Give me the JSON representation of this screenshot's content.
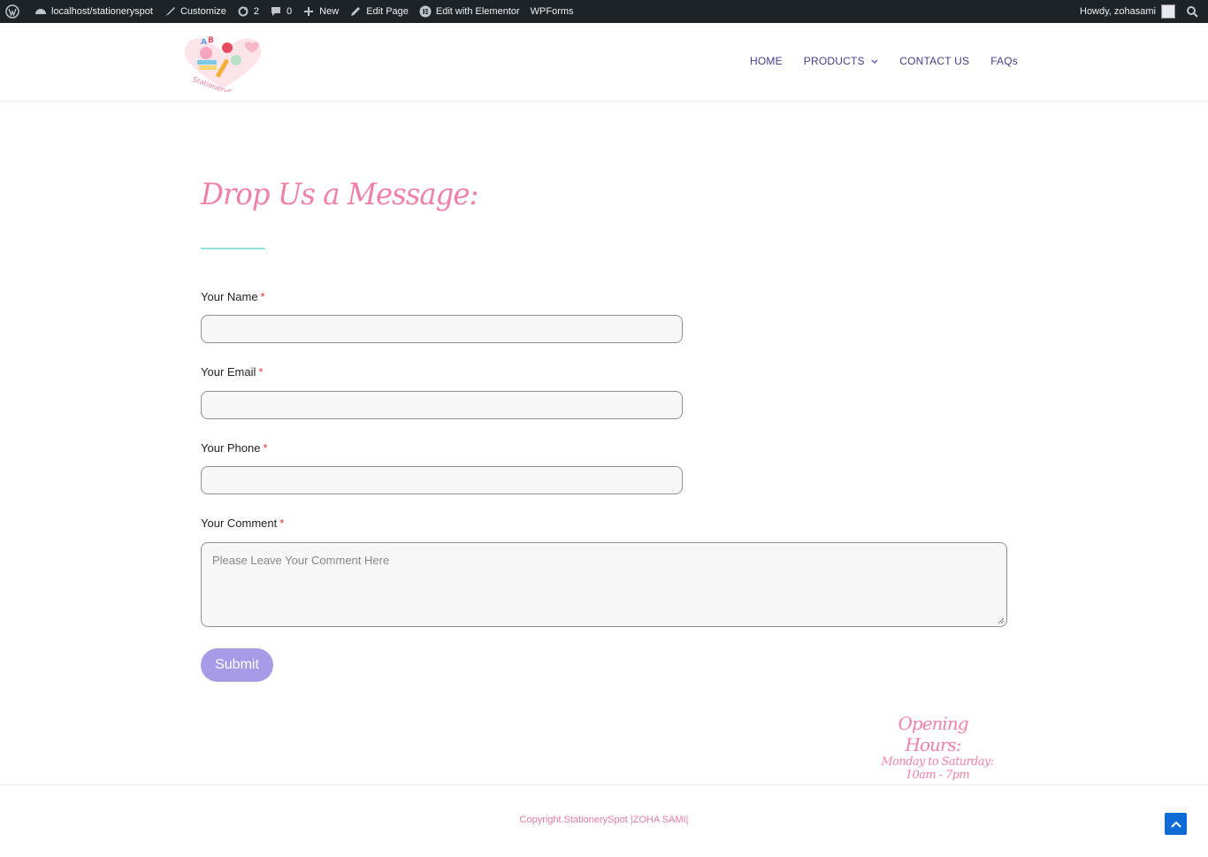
{
  "adminbar": {
    "site": "localhost/stationeryspot",
    "customize": "Customize",
    "updates": "2",
    "comments": "0",
    "new": "New",
    "edit_page": "Edit Page",
    "edit_elementor": "Edit with Elementor",
    "wpforms": "WPForms",
    "howdy": "Howdy, zohasami"
  },
  "header": {
    "logo_text": "StationerySpot",
    "nav": {
      "home": "HOME",
      "products": "PRODUCTS",
      "contact": "CONTACT US",
      "faqs": "FAQs"
    }
  },
  "form": {
    "heading": "Drop Us a Message:",
    "name_label": "Your Name",
    "email_label": "Your Email",
    "phone_label": "Your Phone",
    "comment_label": "Your Comment",
    "required_mark": "*",
    "comment_placeholder": "Please Leave Your Comment Here",
    "submit": "Submit"
  },
  "hours": {
    "title": "Opening Hours:",
    "text": "Monday to Saturday: 10am - 7pm"
  },
  "footer": {
    "copyright": "Copyright.StationerySpot |ZOHA SAMI|"
  },
  "colors": {
    "accent_pink": "#ee82a6",
    "nav_purple": "#4a3b8c",
    "submit_purple": "#a79ae6",
    "divider_teal": "#8fe3de",
    "adminbar_bg": "#1d2327"
  }
}
